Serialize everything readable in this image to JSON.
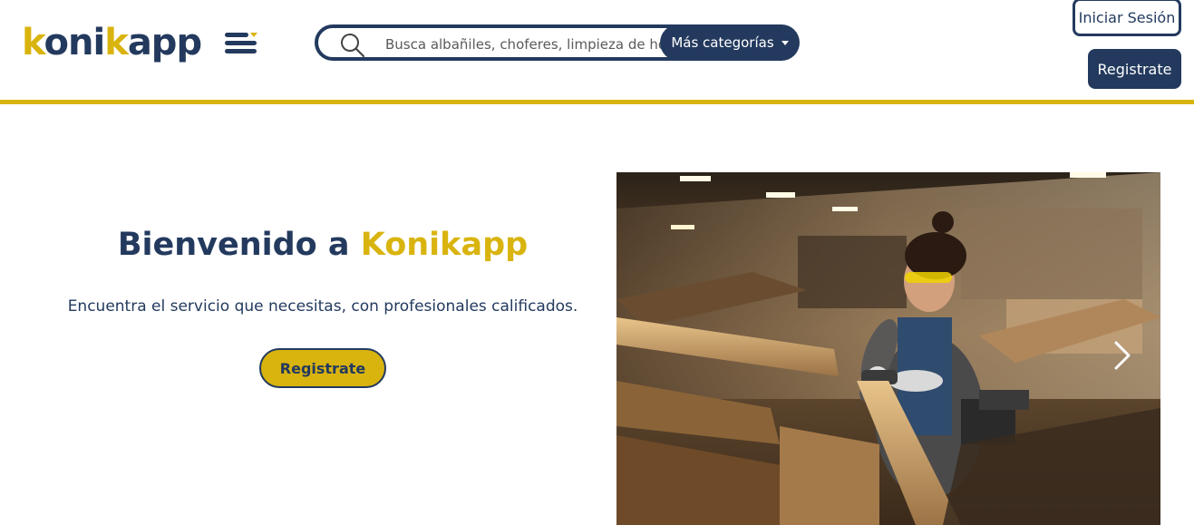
{
  "header": {
    "logo": {
      "part1": "k",
      "part2": "oni",
      "part3": "k",
      "part4": "app"
    },
    "menu_icon": "hamburger-menu-icon",
    "search": {
      "placeholder": "Busca albañiles, choferes, limpieza de hogar...",
      "icon": "search-icon",
      "category_button": "Más categorías"
    },
    "login_button": "Iniciar Sesión",
    "register_button": "Registrate"
  },
  "hero": {
    "title_prefix": "Bienvenido a ",
    "title_brand": "Konikapp",
    "subtitle": "Encuentra el servicio que necesitas, con profesionales calificados.",
    "cta_button": "Registrate"
  },
  "carousel": {
    "image": "woman-grinding-wood-in-workshop",
    "next_icon": "chevron-right-icon"
  },
  "colors": {
    "brand_navy": "#233a5e",
    "brand_yellow": "#d9b40f"
  }
}
